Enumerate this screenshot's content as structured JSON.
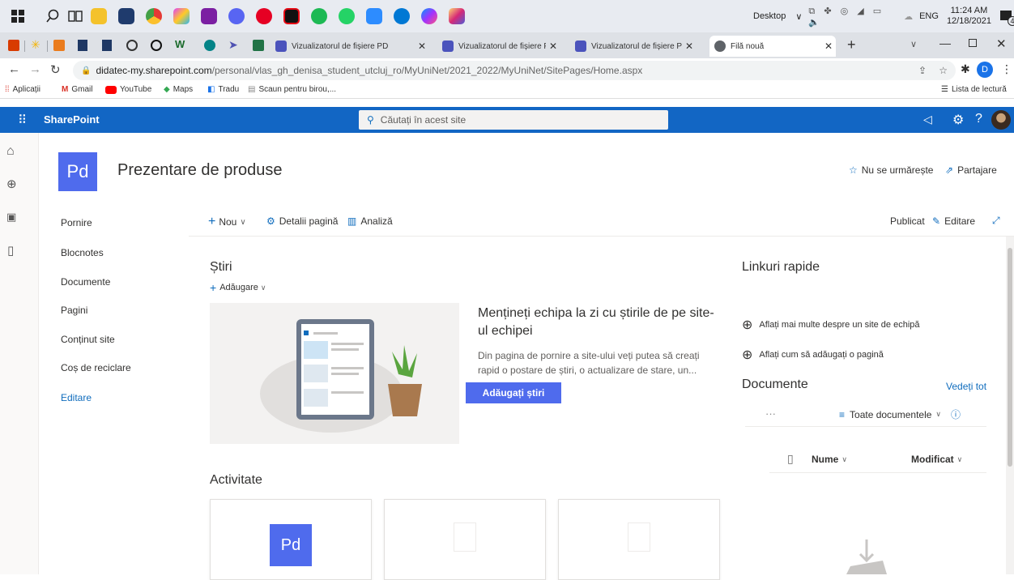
{
  "taskbar": {
    "desktop_label": "Desktop",
    "language": "ENG",
    "time": "11:24 AM",
    "date": "12/18/2021",
    "notification_count": "4"
  },
  "browser": {
    "tabs": [
      {
        "title": "Vizualizatorul de fișiere PD"
      },
      {
        "title": "Vizualizatorul de fișiere PD"
      },
      {
        "title": "Vizualizatorul de fișiere PD"
      },
      {
        "title": "Filă nouă"
      }
    ],
    "url_domain": "didatec-my.sharepoint.com",
    "url_path": "/personal/vlas_gh_denisa_student_utcluj_ro/MyUniNet/2021_2022/MyUniNet/SitePages/Home.aspx",
    "profile_initial": "D",
    "bookmarks": [
      "Aplicații",
      "Gmail",
      "YouTube",
      "Maps",
      "Tradu",
      "Scaun pentru birou,..."
    ],
    "reading_list": "Lista de lectură"
  },
  "sharepoint": {
    "app_name": "SharePoint",
    "search_placeholder": "Căutați în acest site"
  },
  "site": {
    "logo_initials": "Pd",
    "title": "Prezentare de produse",
    "follow_label": "Nu se urmărește",
    "share_label": "Partajare"
  },
  "nav": {
    "items": [
      "Pornire",
      "Blocnotes",
      "Documente",
      "Pagini",
      "Conținut site",
      "Coș de reciclare"
    ],
    "edit_link": "Editare"
  },
  "command_bar": {
    "new_label": "Nou",
    "page_details": "Detalii pagină",
    "analytics": "Analiză",
    "status": "Publicat",
    "edit_label": "Editare"
  },
  "news": {
    "heading": "Știri",
    "add_label": "Adăugare",
    "promo_title": "Mențineți echipa la zi cu știrile de pe site-ul echipei",
    "promo_body": "Din pagina de pornire a site-ului veți putea să creați rapid o postare de știri, o actualizare de stare, un...",
    "add_news_button": "Adăugați știri"
  },
  "activity": {
    "heading": "Activitate",
    "card_initials": "Pd"
  },
  "quick_links": {
    "heading": "Linkuri rapide",
    "links": [
      "Aflați mai multe despre un site de echipă",
      "Aflați cum să adăugați o pagină"
    ]
  },
  "documents": {
    "heading": "Documente",
    "see_all": "Vedeți tot",
    "more": "···",
    "view_label": "Toate documentele",
    "col_name": "Nume",
    "col_modified": "Modificat"
  }
}
